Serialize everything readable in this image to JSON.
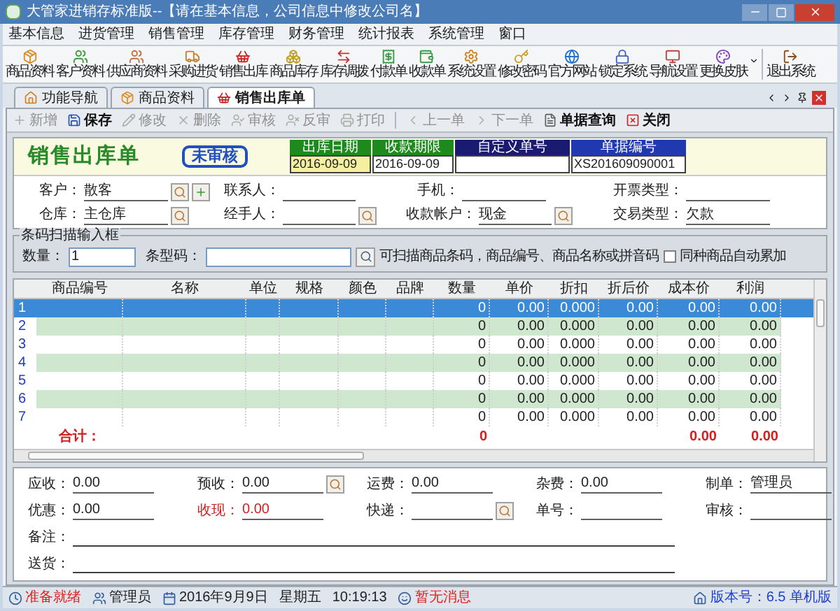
{
  "window": {
    "title": "大管家进销存标准版--【请在基本信息，公司信息中修改公司名】"
  },
  "menu": [
    "基本信息",
    "进货管理",
    "销售管理",
    "库存管理",
    "财务管理",
    "统计报表",
    "系统管理",
    "窗口"
  ],
  "toolbar": {
    "items": [
      {
        "label": "商品资料",
        "kind": "button"
      },
      {
        "label": "客户资料",
        "kind": "button"
      },
      {
        "label": "供应商资料",
        "kind": "button"
      },
      {
        "label": "采购进货",
        "kind": "button"
      },
      {
        "label": "销售出库",
        "kind": "button"
      },
      {
        "label": "商品库存",
        "kind": "button"
      },
      {
        "label": "库存调拨",
        "kind": "button"
      },
      {
        "label": "付款单",
        "kind": "button"
      },
      {
        "label": "收款单",
        "kind": "button"
      },
      {
        "label": "系统设置",
        "kind": "button"
      },
      {
        "label": "修改密码",
        "kind": "button"
      },
      {
        "label": "官方网站",
        "kind": "button"
      },
      {
        "label": "锁定系统",
        "kind": "button"
      },
      {
        "label": "导航设置",
        "kind": "button"
      },
      {
        "label": "更换皮肤",
        "kind": "dropdown"
      }
    ],
    "trailing": [
      {
        "label": "退出系统",
        "kind": "button"
      }
    ]
  },
  "tabs": [
    {
      "label": "功能导航",
      "selected": false
    },
    {
      "label": "商品资料",
      "selected": false
    },
    {
      "label": "销售出库单",
      "selected": true
    }
  ],
  "actions": [
    {
      "label": "新增",
      "disabled": true
    },
    {
      "label": "保存",
      "disabled": false
    },
    {
      "label": "修改",
      "disabled": true
    },
    {
      "label": "删除",
      "disabled": true
    },
    {
      "label": "审核",
      "disabled": true
    },
    {
      "label": "反审",
      "disabled": true
    },
    {
      "label": "打印",
      "disabled": true
    },
    {
      "label": "上一单",
      "disabled": true
    },
    {
      "label": "下一单",
      "disabled": true
    },
    {
      "label": "单据查询",
      "disabled": false
    },
    {
      "label": "关闭",
      "disabled": false
    }
  ],
  "document": {
    "title": "销售出库单",
    "status": "未审核",
    "fields": [
      {
        "label": "出库日期",
        "value": "2016-09-09",
        "kind": "date",
        "focused": true
      },
      {
        "label": "收款期限",
        "value": "2016-09-09",
        "kind": "date",
        "focused": false
      },
      {
        "label": "自定义单号",
        "kind": "custom",
        "focused": false
      },
      {
        "label": "单据编号",
        "value": "XS201609090001",
        "kind": "number",
        "focused": false
      }
    ]
  },
  "header_form": [
    [
      {
        "label": "客户：",
        "value": "散客",
        "picker": true,
        "add": true
      },
      {
        "label": "联系人："
      },
      {
        "label": "手机："
      },
      {
        "label": "开票类型："
      }
    ],
    [
      {
        "label": "仓库：",
        "value": "主仓库",
        "picker": true
      },
      {
        "label": "经手人：",
        "picker": true
      },
      {
        "label": "收款帐户：",
        "value": "现金",
        "picker": true
      },
      {
        "label": "交易类型：",
        "value": "欠款"
      }
    ]
  ],
  "barcode": {
    "title": "条码扫描输入框",
    "quantity_label": "数量：",
    "quantity": "1",
    "code_label": "条型码：",
    "hint": "可扫描商品条码，商品编号、商品名称或拼音码",
    "accumulate": {
      "label": "同种商品自动累加",
      "checked": false
    }
  },
  "table": {
    "columns": [
      "商品编号",
      "名称",
      "单位",
      "规格",
      "颜色",
      "品牌",
      "数量",
      "单价",
      "折扣",
      "折后价",
      "成本价",
      "利润"
    ],
    "rows": [
      {
        "number": "1",
        "selected": true,
        "values": [
          "0",
          "0.00",
          "0.000",
          "0.00",
          "0.00",
          "0.00"
        ]
      },
      {
        "number": "2",
        "selected": false,
        "values": [
          "0",
          "0.00",
          "0.000",
          "0.00",
          "0.00",
          "0.00"
        ]
      },
      {
        "number": "3",
        "selected": false,
        "values": [
          "0",
          "0.00",
          "0.000",
          "0.00",
          "0.00",
          "0.00"
        ]
      },
      {
        "number": "4",
        "selected": false,
        "values": [
          "0",
          "0.00",
          "0.000",
          "0.00",
          "0.00",
          "0.00"
        ]
      },
      {
        "number": "5",
        "selected": false,
        "values": [
          "0",
          "0.00",
          "0.000",
          "0.00",
          "0.00",
          "0.00"
        ]
      },
      {
        "number": "6",
        "selected": false,
        "values": [
          "0",
          "0.00",
          "0.000",
          "0.00",
          "0.00",
          "0.00"
        ]
      },
      {
        "number": "7",
        "selected": false,
        "values": [
          "0",
          "0.00",
          "0.000",
          "0.00",
          "0.00",
          "0.00"
        ]
      }
    ],
    "total": {
      "label": "合计：",
      "quantity": "0",
      "cost_price": "0.00",
      "profit": "0.00"
    }
  },
  "footer_form": [
    [
      {
        "label": "应收：",
        "value": "0.00",
        "highlight": false
      },
      {
        "label": "预收：",
        "value": "0.00",
        "highlight": false,
        "picker": true
      },
      {
        "label": "运费：",
        "value": "0.00",
        "highlight": false
      },
      {
        "label": "杂费：",
        "value": "0.00",
        "highlight": false
      },
      {
        "label": "制单：",
        "value": "管理员",
        "highlight": false
      }
    ],
    [
      {
        "label": "优惠：",
        "value": "0.00",
        "highlight": false
      },
      {
        "label": "收现：",
        "value": "0.00",
        "highlight": true
      },
      {
        "label": "快递：",
        "highlight": false,
        "picker": true
      },
      {
        "label": "单号：",
        "highlight": false
      },
      {
        "label": "审核：",
        "highlight": false
      }
    ],
    [
      {
        "label": "备注：",
        "highlight": false,
        "kind": "wide"
      }
    ],
    [
      {
        "label": "送货：",
        "highlight": false,
        "kind": "wide"
      }
    ]
  ],
  "status_bar": [
    {
      "text": "准备就绪",
      "color": "#e02020"
    },
    {
      "text": "管理员",
      "color": "#202020"
    },
    {
      "text": "2016年9月9日",
      "color": "#202020"
    },
    {
      "text": "星期五",
      "color": "#202020"
    },
    {
      "text": "10:19:13",
      "color": "#202020"
    },
    {
      "text": "暂无消息",
      "color": "#e02020"
    },
    {
      "text": "版本号：6.5 单机版",
      "color": "#1f3fd0"
    }
  ]
}
